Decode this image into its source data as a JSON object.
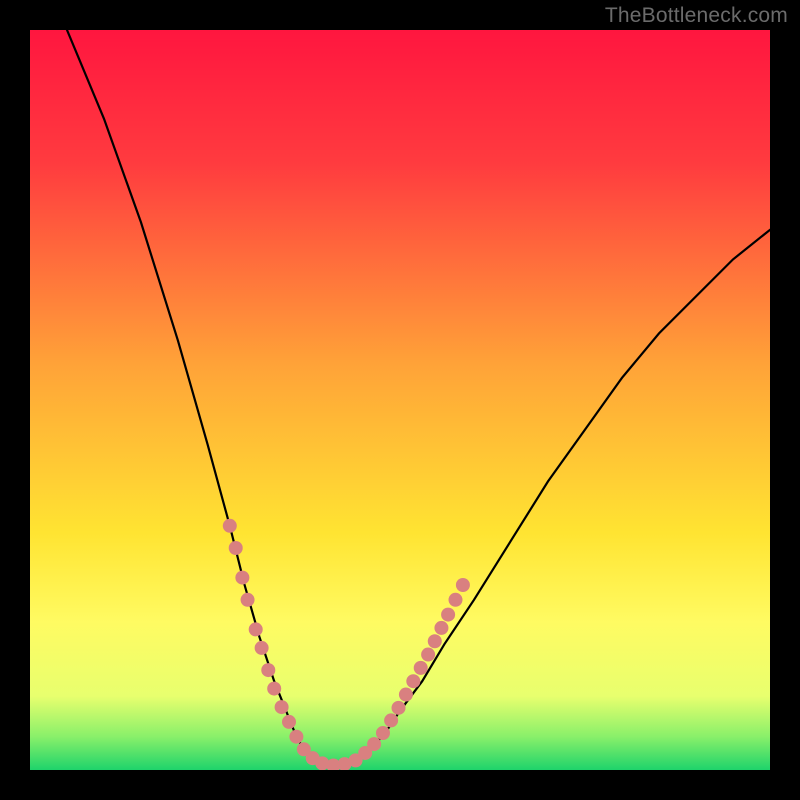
{
  "watermark": "TheBottleneck.com",
  "colors": {
    "frame": "#000000",
    "gradient_stops": [
      {
        "offset": 0.0,
        "color": "#ff163f"
      },
      {
        "offset": 0.18,
        "color": "#ff3b3f"
      },
      {
        "offset": 0.45,
        "color": "#ffa238"
      },
      {
        "offset": 0.68,
        "color": "#ffe432"
      },
      {
        "offset": 0.8,
        "color": "#fffb62"
      },
      {
        "offset": 0.9,
        "color": "#e8ff6e"
      },
      {
        "offset": 0.955,
        "color": "#89f06a"
      },
      {
        "offset": 1.0,
        "color": "#1ed36b"
      }
    ],
    "curve": "#000000",
    "beads": "#d98080"
  },
  "chart_data": {
    "type": "line",
    "title": "",
    "xlabel": "",
    "ylabel": "",
    "xlim": [
      0,
      100
    ],
    "ylim": [
      0,
      100
    ],
    "series": [
      {
        "name": "bottleneck-curve",
        "x": [
          5,
          10,
          15,
          20,
          24,
          27,
          29,
          31,
          33,
          35,
          36,
          37,
          38,
          39,
          40,
          42,
          44,
          46,
          48,
          50,
          53,
          56,
          60,
          65,
          70,
          75,
          80,
          85,
          90,
          95,
          100
        ],
        "y": [
          100,
          88,
          74,
          58,
          44,
          33,
          25,
          18,
          12,
          7,
          4.5,
          2.8,
          1.8,
          1.1,
          0.7,
          0.6,
          1.2,
          2.8,
          5,
          8,
          12,
          17,
          23,
          31,
          39,
          46,
          53,
          59,
          64,
          69,
          73
        ]
      }
    ],
    "beads": [
      {
        "x": 27.0,
        "y": 33.0
      },
      {
        "x": 27.8,
        "y": 30.0
      },
      {
        "x": 28.7,
        "y": 26.0
      },
      {
        "x": 29.4,
        "y": 23.0
      },
      {
        "x": 30.5,
        "y": 19.0
      },
      {
        "x": 31.3,
        "y": 16.5
      },
      {
        "x": 32.2,
        "y": 13.5
      },
      {
        "x": 33.0,
        "y": 11.0
      },
      {
        "x": 34.0,
        "y": 8.5
      },
      {
        "x": 35.0,
        "y": 6.5
      },
      {
        "x": 36.0,
        "y": 4.5
      },
      {
        "x": 37.0,
        "y": 2.8
      },
      {
        "x": 38.2,
        "y": 1.6
      },
      {
        "x": 39.5,
        "y": 0.9
      },
      {
        "x": 41.0,
        "y": 0.6
      },
      {
        "x": 42.5,
        "y": 0.8
      },
      {
        "x": 44.0,
        "y": 1.3
      },
      {
        "x": 45.3,
        "y": 2.3
      },
      {
        "x": 46.5,
        "y": 3.5
      },
      {
        "x": 47.7,
        "y": 5.0
      },
      {
        "x": 48.8,
        "y": 6.7
      },
      {
        "x": 49.8,
        "y": 8.4
      },
      {
        "x": 50.8,
        "y": 10.2
      },
      {
        "x": 51.8,
        "y": 12.0
      },
      {
        "x": 52.8,
        "y": 13.8
      },
      {
        "x": 53.8,
        "y": 15.6
      },
      {
        "x": 54.7,
        "y": 17.4
      },
      {
        "x": 55.6,
        "y": 19.2
      },
      {
        "x": 56.5,
        "y": 21.0
      },
      {
        "x": 57.5,
        "y": 23.0
      },
      {
        "x": 58.5,
        "y": 25.0
      }
    ]
  }
}
